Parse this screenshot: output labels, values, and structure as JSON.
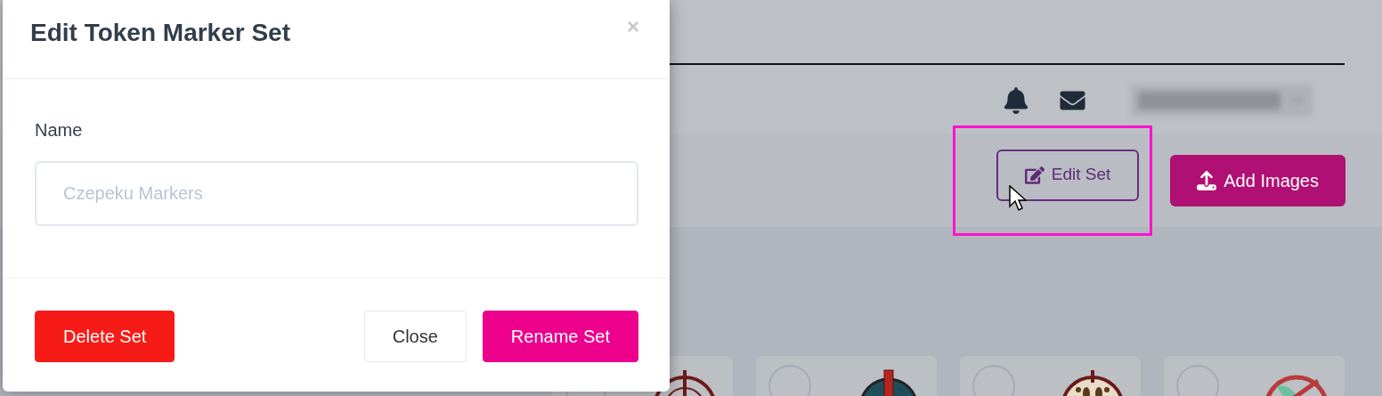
{
  "page": {
    "actions": [
      {
        "label": "Edit Set",
        "kind": "outline",
        "highlighted": true
      },
      {
        "label": "Add Images",
        "kind": "upload",
        "highlighted": false
      }
    ]
  },
  "modal": {
    "title": "Edit Token Marker Set",
    "close": "×",
    "field": {
      "label": "Name",
      "placeholder": "Czepeku Markers"
    },
    "buttons": [
      {
        "label": "Delete Set",
        "kind": "danger"
      },
      {
        "label": "Close",
        "kind": "plain"
      },
      {
        "label": "Rename Set",
        "kind": "primary"
      }
    ]
  }
}
